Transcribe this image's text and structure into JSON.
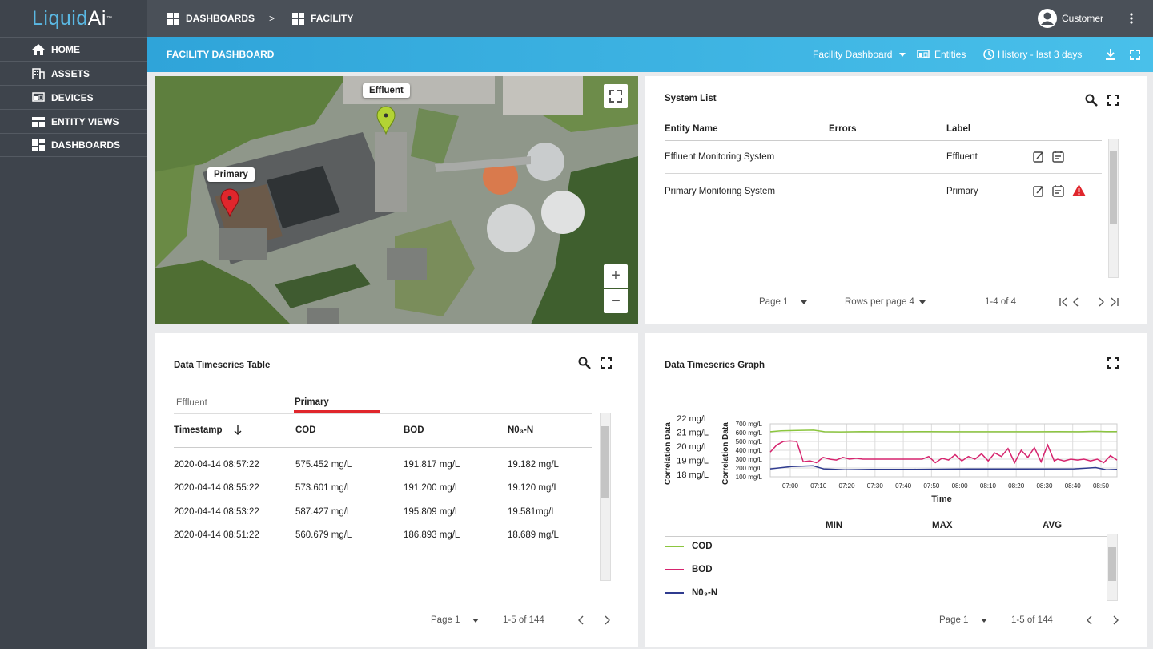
{
  "app": {
    "logo_liquid": "Liquid",
    "logo_ai": "Ai",
    "logo_tm": "™"
  },
  "sidebar": {
    "items": [
      {
        "label": "HOME",
        "icon": "home-icon"
      },
      {
        "label": "ASSETS",
        "icon": "building-icon"
      },
      {
        "label": "DEVICES",
        "icon": "devices-icon"
      },
      {
        "label": "ENTITY VIEWS",
        "icon": "entity-views-icon"
      },
      {
        "label": "DASHBOARDS",
        "icon": "dashboards-icon"
      }
    ]
  },
  "topbar": {
    "crumb1": "DASHBOARDS",
    "separator": ">",
    "crumb2": "FACILITY",
    "user": "Customer"
  },
  "dashbar": {
    "title": "FACILITY DASHBOARD",
    "selector": "Facility Dashboard",
    "entities": "Entities",
    "history": "History - last 3 days"
  },
  "map": {
    "markers": [
      {
        "label": "Effluent",
        "color": "#b3d334"
      },
      {
        "label": "Primary",
        "color": "#e0262c"
      }
    ],
    "zoom_in": "+",
    "zoom_out": "−"
  },
  "system_list": {
    "title": "System List",
    "headers": [
      "Entity Name",
      "Errors",
      "Label"
    ],
    "rows": [
      {
        "name": "Effluent Monitoring System",
        "errors": "",
        "label": "Effluent",
        "warning": false
      },
      {
        "name": "Primary Monitoring System",
        "errors": "",
        "label": "Primary",
        "warning": true
      }
    ],
    "page": "Page 1",
    "rows_per_page": "Rows per page 4",
    "range": "1-4 of 4"
  },
  "ts_table": {
    "title": "Data Timeseries Table",
    "tabs": [
      "Effluent",
      "Primary"
    ],
    "active_tab": "Primary",
    "headers": [
      "Timestamp",
      "COD",
      "BOD",
      "N0₃-N"
    ],
    "rows": [
      [
        "2020-04-14 08:57:22",
        "575.452 mg/L",
        "191.817 mg/L",
        "19.182 mg/L"
      ],
      [
        "2020-04-14 08:55:22",
        "573.601 mg/L",
        "191.200 mg/L",
        "19.120 mg/L"
      ],
      [
        "2020-04-14 08:53:22",
        "587.427 mg/L",
        "195.809 mg/L",
        "19.581mg/L"
      ],
      [
        "2020-04-14 08:51:22",
        "560.679 mg/L",
        "186.893 mg/L",
        "18.689 mg/L"
      ]
    ],
    "page": "Page 1",
    "range": "1-5 of 144"
  },
  "ts_graph": {
    "title": "Data Timeseries Graph",
    "stats_headers": [
      "MIN",
      "MAX",
      "AVG"
    ],
    "page": "Page 1",
    "range": "1-5 of 144"
  },
  "chart_data": {
    "type": "line",
    "title": "",
    "xlabel": "Time",
    "ylabel_left": "Correlation Data",
    "ylabel_right": "Correlation Data",
    "left_ticks": [
      "22 mg/L",
      "21 mg/L",
      "20 mg/L",
      "19 mg/L",
      "18 mg/L"
    ],
    "right_ticks": [
      "700 mg/L",
      "600 mg/L",
      "500 mg/L",
      "400 mg/L",
      "300 mg/L",
      "200 mg/L",
      "100 mg/L"
    ],
    "ylim_right": [
      100,
      700
    ],
    "x_ticks": [
      "07:00",
      "07:10",
      "07:20",
      "07:30",
      "07:40",
      "07:50",
      "08:00",
      "08:10",
      "08:20",
      "08:30",
      "08:40",
      "08:50"
    ],
    "xlim_minutes_from_0700": [
      -7,
      58
    ],
    "series": [
      {
        "name": "COD",
        "color": "#8cc63f",
        "points": [
          [
            -7,
            610
          ],
          [
            -5,
            620
          ],
          [
            -2,
            625
          ],
          [
            1,
            628
          ],
          [
            3,
            610
          ],
          [
            6,
            608
          ],
          [
            10,
            612
          ],
          [
            14,
            610
          ],
          [
            18,
            610
          ],
          [
            22,
            612
          ],
          [
            26,
            610
          ],
          [
            30,
            610
          ],
          [
            34,
            610
          ],
          [
            38,
            610
          ],
          [
            42,
            610
          ],
          [
            46,
            612
          ],
          [
            50,
            610
          ],
          [
            53,
            615
          ],
          [
            55,
            612
          ],
          [
            57,
            612
          ]
        ]
      },
      {
        "name": "BOD",
        "color": "#d6246e",
        "points": [
          [
            -7,
            380
          ],
          [
            -5,
            460
          ],
          [
            -3,
            500
          ],
          [
            -1,
            505
          ],
          [
            1,
            500
          ],
          [
            3,
            270
          ],
          [
            5,
            280
          ],
          [
            7,
            260
          ],
          [
            9,
            320
          ],
          [
            11,
            300
          ],
          [
            13,
            290
          ],
          [
            15,
            320
          ],
          [
            17,
            300
          ],
          [
            19,
            310
          ],
          [
            21,
            300
          ],
          [
            24,
            300
          ],
          [
            27,
            300
          ],
          [
            30,
            300
          ],
          [
            33,
            300
          ],
          [
            36,
            300
          ],
          [
            39,
            300
          ],
          [
            41,
            330
          ],
          [
            43,
            260
          ],
          [
            45,
            310
          ],
          [
            47,
            290
          ],
          [
            49,
            350
          ],
          [
            51,
            280
          ],
          [
            53,
            330
          ],
          [
            55,
            300
          ],
          [
            57,
            360
          ],
          [
            59,
            280
          ],
          [
            61,
            370
          ],
          [
            63,
            330
          ],
          [
            65,
            420
          ],
          [
            67,
            260
          ],
          [
            69,
            400
          ],
          [
            71,
            320
          ],
          [
            73,
            430
          ],
          [
            75,
            270
          ],
          [
            77,
            460
          ],
          [
            79,
            280
          ],
          [
            80,
            300
          ],
          [
            82,
            280
          ],
          [
            84,
            300
          ],
          [
            86,
            290
          ],
          [
            88,
            300
          ],
          [
            90,
            280
          ],
          [
            92,
            300
          ],
          [
            94,
            260
          ],
          [
            96,
            340
          ],
          [
            98,
            290
          ]
        ]
      },
      {
        "name": "N0₃-N",
        "color": "#2f3b8f",
        "points": [
          [
            -7,
            190
          ],
          [
            -3,
            215
          ],
          [
            1,
            225
          ],
          [
            3,
            190
          ],
          [
            7,
            180
          ],
          [
            12,
            185
          ],
          [
            20,
            185
          ],
          [
            30,
            188
          ],
          [
            40,
            188
          ],
          [
            50,
            190
          ],
          [
            54,
            205
          ],
          [
            56,
            180
          ],
          [
            58,
            185
          ]
        ]
      }
    ]
  }
}
